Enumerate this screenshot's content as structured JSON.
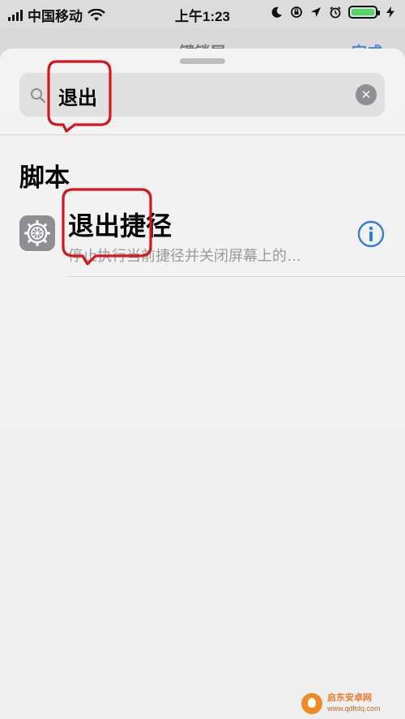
{
  "status_bar": {
    "carrier": "中国移动",
    "time": "上午1:23"
  },
  "underlying_header": {
    "title": "键锁屏",
    "done": "完成"
  },
  "search": {
    "value": "退出"
  },
  "section": {
    "title": "脚本"
  },
  "result": {
    "title": "退出捷径",
    "subtitle": "停止执行当前捷径并关闭屏幕上的…",
    "icon": "gear-icon"
  },
  "watermark": {
    "name": "启东安卓网",
    "url": "www.qdltdq.com"
  },
  "colors": {
    "accent": "#2d7de0",
    "battery": "#4cd964",
    "annotation": "#d9141c"
  }
}
